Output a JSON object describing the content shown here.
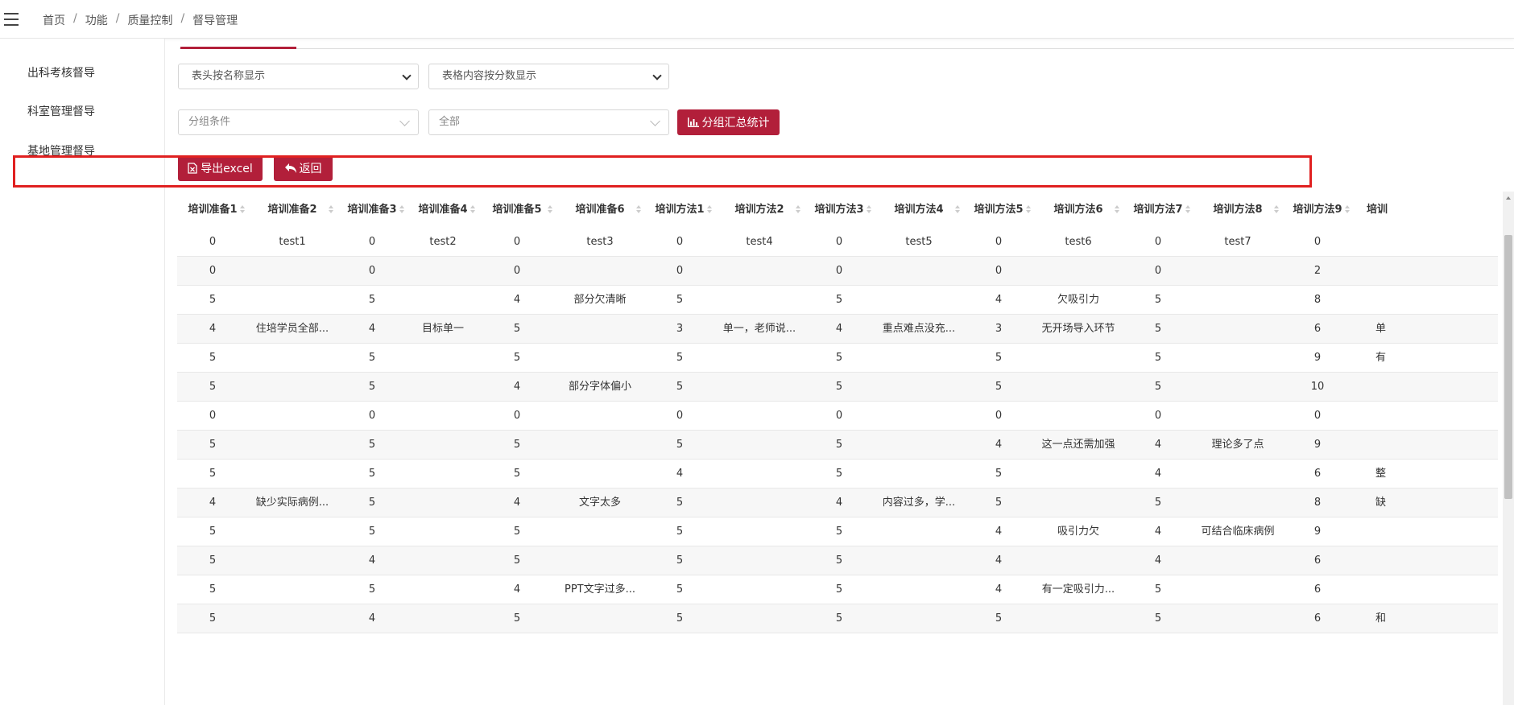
{
  "breadcrumb": [
    "首页",
    "功能",
    "质量控制",
    "督导管理"
  ],
  "sidebar": {
    "items": [
      "出科考核督导",
      "科室管理督导",
      "基地管理督导"
    ]
  },
  "filters": {
    "header_display": "表头按名称显示",
    "content_display": "表格内容按分数显示",
    "group_condition_placeholder": "分组条件",
    "group_value": "全部"
  },
  "buttons": {
    "group_stats": "分组汇总统计",
    "export": "导出excel",
    "back": "返回"
  },
  "colors": {
    "accent": "#b21f3a",
    "highlight_border": "#e02020"
  },
  "table": {
    "columns": [
      "培训准备1",
      "培训准备2",
      "培训准备3",
      "培训准备4",
      "培训准备5",
      "培训准备6",
      "培训方法1",
      "培训方法2",
      "培训方法3",
      "培训方法4",
      "培训方法5",
      "培训方法6",
      "培训方法7",
      "培训方法8",
      "培训方法9",
      "培训"
    ],
    "rows": [
      [
        "0",
        "test1",
        "0",
        "test2",
        "0",
        "test3",
        "0",
        "test4",
        "0",
        "test5",
        "0",
        "test6",
        "0",
        "test7",
        "0",
        ""
      ],
      [
        "0",
        "",
        "0",
        "",
        "0",
        "",
        "0",
        "",
        "0",
        "",
        "0",
        "",
        "0",
        "",
        "2",
        ""
      ],
      [
        "5",
        "",
        "5",
        "",
        "4",
        "部分欠清晰",
        "5",
        "",
        "5",
        "",
        "4",
        "欠吸引力",
        "5",
        "",
        "8",
        ""
      ],
      [
        "4",
        "住培学员全部...",
        "4",
        "目标单一",
        "5",
        "",
        "3",
        "单一，老师说...",
        "4",
        "重点难点没充...",
        "3",
        "无开场导入环节",
        "5",
        "",
        "6",
        "单"
      ],
      [
        "5",
        "",
        "5",
        "",
        "5",
        "",
        "5",
        "",
        "5",
        "",
        "5",
        "",
        "5",
        "",
        "9",
        "有"
      ],
      [
        "5",
        "",
        "5",
        "",
        "4",
        "部分字体偏小",
        "5",
        "",
        "5",
        "",
        "5",
        "",
        "5",
        "",
        "10",
        ""
      ],
      [
        "0",
        "",
        "0",
        "",
        "0",
        "",
        "0",
        "",
        "0",
        "",
        "0",
        "",
        "0",
        "",
        "0",
        ""
      ],
      [
        "5",
        "",
        "5",
        "",
        "5",
        "",
        "5",
        "",
        "5",
        "",
        "4",
        "这一点还需加强",
        "4",
        "理论多了点",
        "9",
        ""
      ],
      [
        "5",
        "",
        "5",
        "",
        "5",
        "",
        "4",
        "",
        "5",
        "",
        "5",
        "",
        "4",
        "",
        "6",
        "整"
      ],
      [
        "4",
        "缺少实际病例...",
        "5",
        "",
        "4",
        "文字太多",
        "5",
        "",
        "4",
        "内容过多，学...",
        "5",
        "",
        "5",
        "",
        "8",
        "缺"
      ],
      [
        "5",
        "",
        "5",
        "",
        "5",
        "",
        "5",
        "",
        "5",
        "",
        "4",
        "吸引力欠",
        "4",
        "可结合临床病例",
        "9",
        ""
      ],
      [
        "5",
        "",
        "4",
        "",
        "5",
        "",
        "5",
        "",
        "5",
        "",
        "4",
        "",
        "4",
        "",
        "6",
        ""
      ],
      [
        "5",
        "",
        "5",
        "",
        "4",
        "PPT文字过多...",
        "5",
        "",
        "5",
        "",
        "4",
        "有一定吸引力...",
        "5",
        "",
        "6",
        ""
      ],
      [
        "5",
        "",
        "4",
        "",
        "5",
        "",
        "5",
        "",
        "5",
        "",
        "5",
        "",
        "5",
        "",
        "6",
        "和"
      ]
    ]
  }
}
